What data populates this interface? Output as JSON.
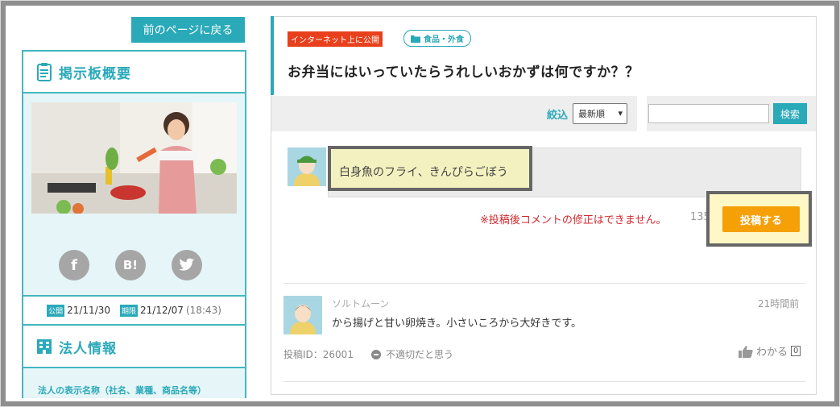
{
  "sidebar": {
    "back_label": "前のページに戻る",
    "overview_title": "掲示板概要",
    "share": {
      "facebook": "f",
      "hatena": "B!",
      "twitter": "twitter"
    },
    "dates": {
      "open_tag": "公開",
      "open_date": "21/11/30",
      "close_tag": "期限",
      "close_date": "21/12/07",
      "close_time": "(18:43)"
    },
    "corp_title": "法人情報",
    "corp_label": "法人の表示名称（社名、業種、商品名等）"
  },
  "thread": {
    "badge_public": "インターネット上に公開",
    "category": "食品・外食",
    "title": "お弁当にはいっていたらうれしいおかずは何ですか？？"
  },
  "filter": {
    "label": "絞込",
    "sort_value": "最新順",
    "search_placeholder": "",
    "search_button": "検索"
  },
  "composer": {
    "text": "白身魚のフライ、きんぴらごぼう",
    "warning": "※投稿後コメントの修正はできません。",
    "count": "135",
    "post_button": "投稿する"
  },
  "post": {
    "author": "ソルトムーン",
    "time": "21時間前",
    "body": "から揚げと甘い卵焼き。小さいころから大好きです。",
    "id_label": "投稿ID：26001",
    "report_label": "不適切だと思う",
    "like_label": "わかる",
    "like_count": "0"
  },
  "colors": {
    "accent": "#2aa9b9",
    "post_button": "#f6a008",
    "warning": "#d0272c",
    "public_badge": "#e8401c"
  }
}
